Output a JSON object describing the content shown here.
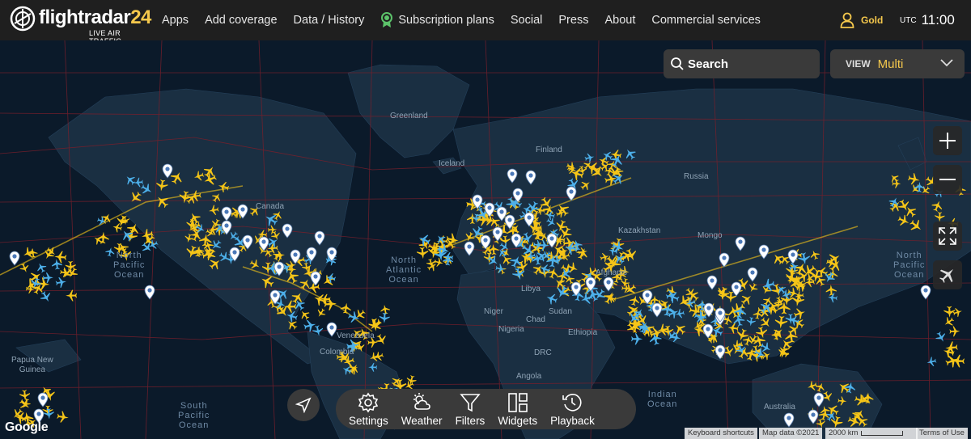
{
  "brand": {
    "name_part1": "flightradar",
    "name_part2": "24",
    "tagline": "LIVE AIR TRAFFIC"
  },
  "nav": [
    {
      "label": "Apps"
    },
    {
      "label": "Add coverage"
    },
    {
      "label": "Data / History"
    },
    {
      "label": "Subscription plans",
      "icon": "ribbon-icon"
    },
    {
      "label": "Social"
    },
    {
      "label": "Press"
    },
    {
      "label": "About"
    },
    {
      "label": "Commercial services"
    }
  ],
  "account": {
    "label": "Gold",
    "icon": "user-icon",
    "color": "#f5c84c"
  },
  "clock": {
    "zone": "UTC",
    "time": "11:00"
  },
  "search": {
    "label": "Search"
  },
  "view": {
    "label": "VIEW",
    "value": "Multi"
  },
  "map_controls": [
    "zoom-in-icon",
    "zoom-out-icon",
    "fullscreen-icon",
    "aircraft-icon"
  ],
  "map_labels": {
    "greenland": "Greenland",
    "finland": "Finland",
    "iceland": "Iceland",
    "russia": "Russia",
    "canada": "Canada",
    "kazakhstan": "Kazakhstan",
    "mongolia": "Mongo",
    "north_pacific_left": "North\nPacific\nOcean",
    "north_pacific_right": "North\nPacific\nOcean",
    "north_atlantic": "North\nAtlantic\nOcean",
    "libya": "Libya",
    "niger": "Niger",
    "chad": "Chad",
    "sudan": "Sudan",
    "nigeria": "Nigeria",
    "ethiopia": "Ethiopia",
    "drc": "DRC",
    "angola": "Angola",
    "afghanistan": "Afghanis",
    "venezuela": "Venezuela",
    "colombia": "Colombia",
    "papua_left": "Papua New\nGuinea",
    "south_pacific": "South\nPacific\nOcean",
    "indian_ocean": "Indian\nOcean",
    "australia": "Australia"
  },
  "bottom_bar": [
    {
      "label": "Settings",
      "icon": "settings-gear-icon"
    },
    {
      "label": "Weather",
      "icon": "weather-icon"
    },
    {
      "label": "Filters",
      "icon": "filter-icon"
    },
    {
      "label": "Widgets",
      "icon": "widgets-icon"
    },
    {
      "label": "Playback",
      "icon": "playback-icon"
    }
  ],
  "attribution": {
    "google": "Google",
    "keyboard": "Keyboard shortcuts",
    "mapdata": "Map data ©2021",
    "scale": "2000 km",
    "terms": "Terms of Use"
  },
  "colors": {
    "plane": "#f5c518",
    "plane_alt": "#4db0ea",
    "map_bg": "#0b1a2a",
    "land": "#1a2f42",
    "border": "#7a1f2b",
    "accent": "#f5c84c"
  }
}
